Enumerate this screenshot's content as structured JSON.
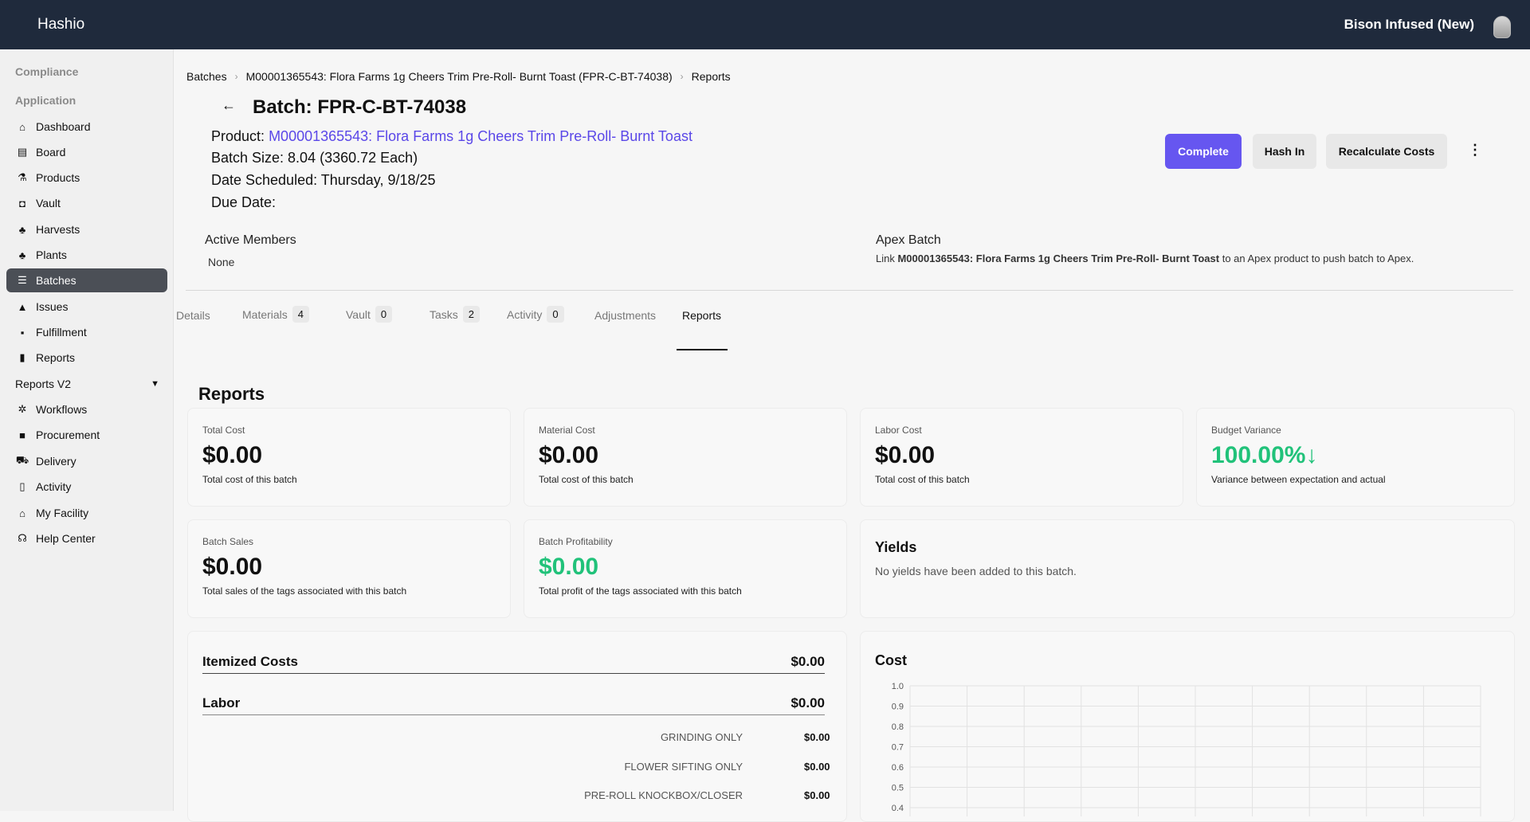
{
  "app": {
    "brand": "Hashio",
    "org": "Bison Infused (New)"
  },
  "sidebar": {
    "sections": [
      "Compliance",
      "Application"
    ],
    "items": [
      {
        "label": "Dashboard",
        "icon": "home-icon"
      },
      {
        "label": "Board",
        "icon": "board-icon"
      },
      {
        "label": "Products",
        "icon": "flask-icon"
      },
      {
        "label": "Vault",
        "icon": "vault-icon"
      },
      {
        "label": "Harvests",
        "icon": "sprout-icon"
      },
      {
        "label": "Plants",
        "icon": "plant-icon"
      },
      {
        "label": "Batches",
        "icon": "layers-icon",
        "active": true
      },
      {
        "label": "Issues",
        "icon": "warning-icon"
      },
      {
        "label": "Fulfillment",
        "icon": "box-icon"
      },
      {
        "label": "Reports",
        "icon": "bar-chart-icon"
      },
      {
        "label": "Reports V2",
        "icon": "chevron-down-icon"
      },
      {
        "label": "Workflows",
        "icon": "workflow-icon"
      },
      {
        "label": "Procurement",
        "icon": "bag-icon"
      },
      {
        "label": "Delivery",
        "icon": "truck-icon"
      },
      {
        "label": "Activity",
        "icon": "clipboard-icon"
      },
      {
        "label": "My Facility",
        "icon": "warehouse-icon"
      },
      {
        "label": "Help Center",
        "icon": "headset-icon"
      }
    ]
  },
  "breadcrumb": [
    "Batches",
    "M00001365543: Flora Farms 1g Cheers Trim Pre-Roll- Burnt Toast (FPR-C-BT-74038)",
    "Reports"
  ],
  "batch": {
    "title": "Batch: FPR-C-BT-74038",
    "product_label": "Product:",
    "product_link": "M00001365543: Flora Farms 1g Cheers Trim Pre-Roll- Burnt Toast",
    "size": "Batch Size: 8.04 (3360.72 Each)",
    "scheduled": "Date Scheduled: Thursday, 9/18/25",
    "due": "Due Date:"
  },
  "actions": {
    "complete": "Complete",
    "hash_in": "Hash In",
    "recalculate": "Recalculate Costs"
  },
  "members": {
    "title": "Active Members",
    "value": "None"
  },
  "apex": {
    "title": "Apex Batch",
    "text_pre": "Link ",
    "text_bold": "M00001365543: Flora Farms 1g Cheers Trim Pre-Roll- Burnt Toast",
    "text_post": " to an Apex product to push batch to Apex."
  },
  "tabs": [
    {
      "label": "Details",
      "count": null
    },
    {
      "label": "Materials",
      "count": "4"
    },
    {
      "label": "Vault",
      "count": "0"
    },
    {
      "label": "Tasks",
      "count": "2"
    },
    {
      "label": "Activity",
      "count": "0"
    },
    {
      "label": "Adjustments",
      "count": null
    },
    {
      "label": "Reports",
      "count": null,
      "active": true
    }
  ],
  "reports": {
    "heading": "Reports",
    "cards": {
      "total_cost": {
        "label": "Total Cost",
        "value": "$0.00",
        "desc": "Total cost of this batch"
      },
      "material_cost": {
        "label": "Material Cost",
        "value": "$0.00",
        "desc": "Total cost of this batch"
      },
      "labor_cost": {
        "label": "Labor Cost",
        "value": "$0.00",
        "desc": "Total cost of this batch"
      },
      "budget_variance": {
        "label": "Budget Variance",
        "value": "100.00%",
        "desc": "Variance between expectation and actual"
      },
      "batch_sales": {
        "label": "Batch Sales",
        "value": "$0.00",
        "desc": "Total sales of the tags associated with this batch"
      },
      "batch_profitability": {
        "label": "Batch Profitability",
        "value": "$0.00",
        "desc": "Total profit of the tags associated with this batch"
      }
    },
    "yields": {
      "title": "Yields",
      "text": "No yields have been added to this batch."
    },
    "itemized": {
      "title": "Itemized Costs",
      "total": "$0.00",
      "labor_title": "Labor",
      "labor_total": "$0.00",
      "lines": [
        {
          "name": "GRINDING ONLY",
          "value": "$0.00"
        },
        {
          "name": "FLOWER SIFTING ONLY",
          "value": "$0.00"
        },
        {
          "name": "PRE-ROLL KNOCKBOX/CLOSER",
          "value": "$0.00"
        }
      ]
    },
    "cost_chart_title": "Cost"
  },
  "colors": {
    "accent": "#6656f0",
    "link": "#5a47e8",
    "positive": "#21c27a",
    "topbar": "#1f2a3c"
  },
  "chart_data": {
    "type": "line",
    "title": "Cost",
    "series": [],
    "ylim": [
      0.4,
      1.0
    ],
    "yticks": [
      "1.0",
      "0.9",
      "0.8",
      "0.7",
      "0.6",
      "0.5",
      "0.4"
    ],
    "grid": true
  }
}
